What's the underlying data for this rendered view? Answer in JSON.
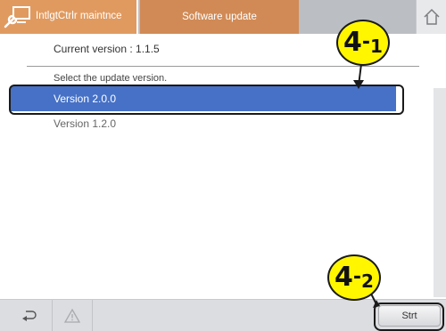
{
  "header": {
    "maintenance_tab": "IntlgtCtrlr maintnce",
    "update_tab": "Software update"
  },
  "content": {
    "current_version": "Current version : 1.1.5",
    "select_label": "Select the update version.",
    "versions": [
      {
        "label": "Version 2.0.0",
        "selected": true
      },
      {
        "label": "Version 1.2.0",
        "selected": false
      }
    ]
  },
  "callouts": {
    "step1": {
      "number": "4",
      "sub": "1"
    },
    "step2": {
      "number": "4",
      "sub": "2"
    }
  },
  "footer": {
    "start_label": "Strt"
  },
  "icons": {
    "maintenance": "wrench-screen-icon",
    "home": "home-icon",
    "back": "back-arrow-icon",
    "warning": "warning-icon"
  },
  "colors": {
    "maintenance_tab": "#e09a60",
    "update_tab": "#d18a55",
    "selected_row": "#4671c6",
    "callout": "#fff600"
  }
}
